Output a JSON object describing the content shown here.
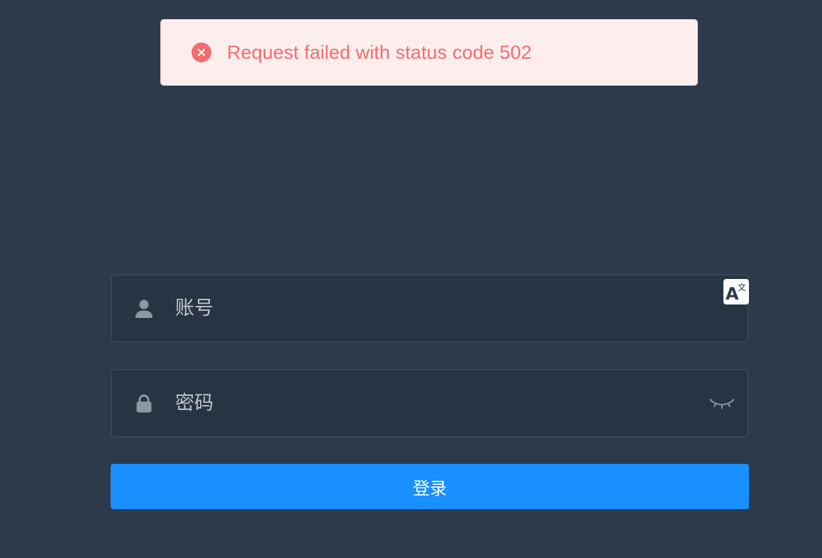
{
  "toast": {
    "type": "error",
    "icon": "error-circle-icon",
    "message": "Request failed with status code 502",
    "color": "#f56c6c"
  },
  "login_form": {
    "username": {
      "icon": "user-icon",
      "placeholder": "账号",
      "value": ""
    },
    "password": {
      "icon": "lock-icon",
      "placeholder": "密码",
      "value": "",
      "toggle_icon": "eye-closed-icon"
    },
    "submit_label": "登录"
  },
  "translate_badge": {
    "icon": "translate-icon",
    "glyph_main": "A",
    "glyph_sub": "文"
  },
  "colors": {
    "background": "#2d3a4b",
    "input_bg": "#283443",
    "accent": "#1890ff",
    "error": "#f56c6c"
  }
}
